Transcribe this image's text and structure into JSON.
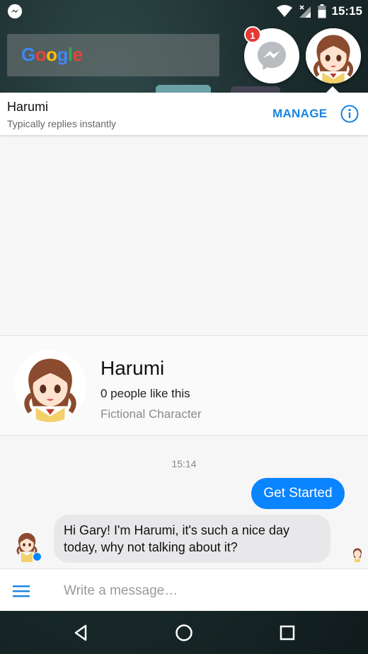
{
  "status_bar": {
    "time": "15:15",
    "icons": [
      "messenger-notification-icon",
      "wifi-icon",
      "signal-icon",
      "battery-icon"
    ]
  },
  "launcher": {
    "google_logo": "Google"
  },
  "chat_heads": {
    "badge_count": "1",
    "icons": [
      "messenger-icon",
      "harumi-avatar"
    ]
  },
  "header": {
    "name": "Harumi",
    "subtitle": "Typically replies instantly",
    "manage_label": "MANAGE",
    "info_icon": "info-icon"
  },
  "profile": {
    "name": "Harumi",
    "likes": "0 people like this",
    "category": "Fictional Character"
  },
  "conversation": {
    "timestamp": "15:14",
    "messages": [
      {
        "from": "me",
        "text": "Get Started"
      },
      {
        "from": "Harumi",
        "text": "Hi Gary! I'm Harumi, it's such a nice day today, why not talking about it?"
      }
    ]
  },
  "composer": {
    "placeholder": "Write a message…",
    "menu_icon": "hamburger-menu-icon"
  },
  "navigation": {
    "icons": [
      "back-icon",
      "home-icon",
      "recents-icon"
    ]
  },
  "colors": {
    "accent": "#0a84ff",
    "manage": "#1a84e0",
    "badge": "#e53935",
    "incoming_bubble": "#e8e8ea"
  }
}
